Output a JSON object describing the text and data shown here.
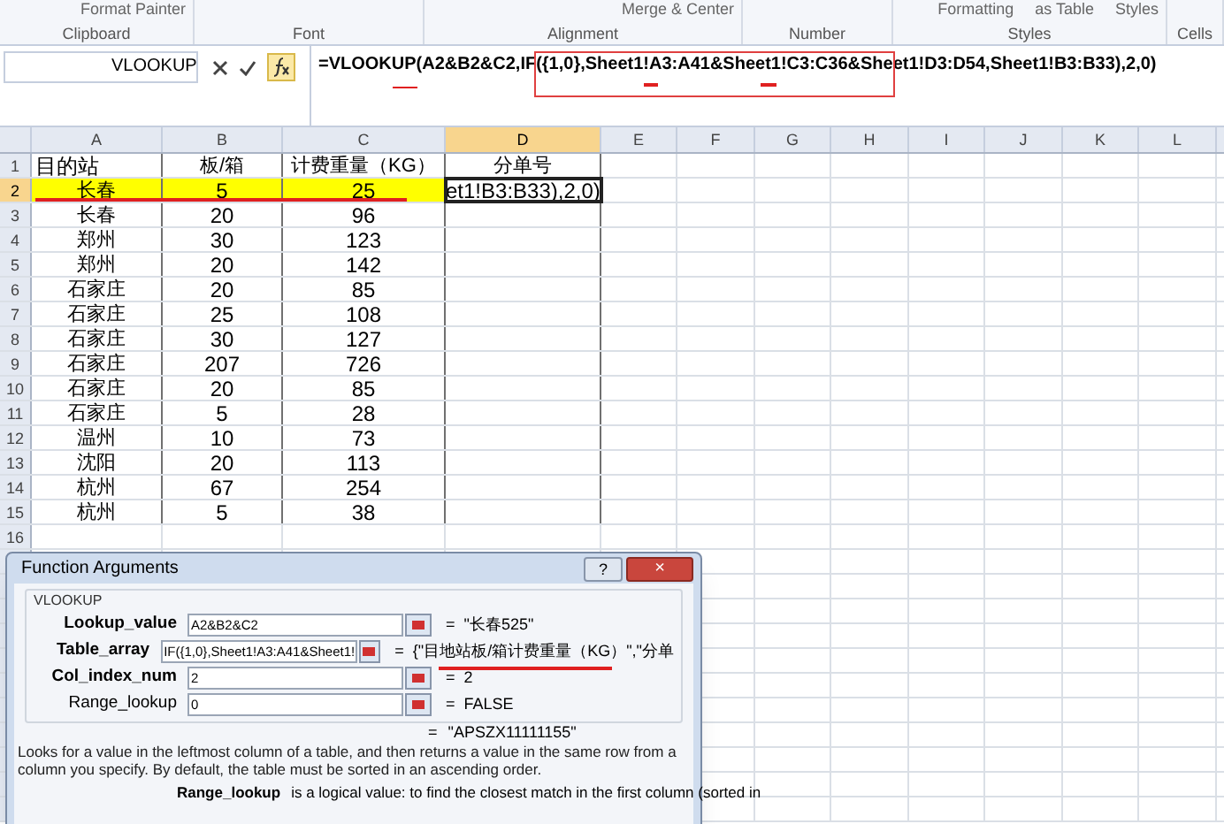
{
  "ribbon": {
    "groups": [
      {
        "label": "Clipboard",
        "items": [
          "Format Painter"
        ]
      },
      {
        "label": "Font"
      },
      {
        "label": "Alignment",
        "items": [
          "Merge & Center"
        ]
      },
      {
        "label": "Number"
      },
      {
        "label": "Styles",
        "items": [
          "Formatting",
          "as Table",
          "Styles"
        ]
      },
      {
        "label": "Cells"
      }
    ]
  },
  "formula_bar": {
    "name_box": "VLOOKUP",
    "formula": "=VLOOKUP(A2&B2&C2,IF({1,0},Sheet1!A3:A41&Sheet1!C3:C36&Sheet1!D3:D54,Sheet1!B3:B33),2,0)"
  },
  "sheet": {
    "columns": [
      {
        "label": "A",
        "selected": false
      },
      {
        "label": "B",
        "selected": false
      },
      {
        "label": "C",
        "selected": false
      },
      {
        "label": "D",
        "selected": true
      },
      {
        "label": "E",
        "selected": false
      },
      {
        "label": "F",
        "selected": false
      },
      {
        "label": "G",
        "selected": false
      },
      {
        "label": "H",
        "selected": false
      },
      {
        "label": "I",
        "selected": false
      },
      {
        "label": "J",
        "selected": false
      },
      {
        "label": "K",
        "selected": false
      },
      {
        "label": "L",
        "selected": false
      }
    ],
    "rows": [
      {
        "number": "1",
        "selected": false,
        "highlighted": false,
        "cells": [
          "目的站",
          "板/箱",
          "计费重量（KG）",
          "分单号"
        ]
      },
      {
        "number": "2",
        "selected": true,
        "highlighted": true,
        "cells": [
          "长春",
          "5",
          "25",
          "et1!B3:B33),2,0)"
        ]
      },
      {
        "number": "3",
        "selected": false,
        "highlighted": false,
        "cells": [
          "长春",
          "20",
          "96"
        ]
      },
      {
        "number": "4",
        "selected": false,
        "highlighted": false,
        "cells": [
          "郑州",
          "30",
          "123"
        ]
      },
      {
        "number": "5",
        "selected": false,
        "highlighted": false,
        "cells": [
          "郑州",
          "20",
          "142"
        ]
      },
      {
        "number": "6",
        "selected": false,
        "highlighted": false,
        "cells": [
          "石家庄",
          "20",
          "85"
        ]
      },
      {
        "number": "7",
        "selected": false,
        "highlighted": false,
        "cells": [
          "石家庄",
          "25",
          "108"
        ]
      },
      {
        "number": "8",
        "selected": false,
        "highlighted": false,
        "cells": [
          "石家庄",
          "30",
          "127"
        ]
      },
      {
        "number": "9",
        "selected": false,
        "highlighted": false,
        "cells": [
          "石家庄",
          "207",
          "726"
        ]
      },
      {
        "number": "10",
        "selected": false,
        "highlighted": false,
        "cells": [
          "石家庄",
          "20",
          "85"
        ]
      },
      {
        "number": "11",
        "selected": false,
        "highlighted": false,
        "cells": [
          "石家庄",
          "5",
          "28"
        ]
      },
      {
        "number": "12",
        "selected": false,
        "highlighted": false,
        "cells": [
          "温州",
          "10",
          "73"
        ]
      },
      {
        "number": "13",
        "selected": false,
        "highlighted": false,
        "cells": [
          "沈阳",
          "20",
          "113"
        ]
      },
      {
        "number": "14",
        "selected": false,
        "highlighted": false,
        "cells": [
          "杭州",
          "67",
          "254"
        ]
      },
      {
        "number": "15",
        "selected": false,
        "highlighted": false,
        "cells": [
          "杭州",
          "5",
          "38"
        ]
      },
      {
        "number": "16",
        "selected": false,
        "highlighted": false,
        "cells": []
      }
    ]
  },
  "dialog": {
    "title": "Function Arguments",
    "help": "?",
    "close": "×",
    "function": "VLOOKUP",
    "arguments": [
      {
        "label": "Lookup_value",
        "kind": "required",
        "value": "A2&B2&C2",
        "result": "\"长春525\""
      },
      {
        "label": "Table_array",
        "kind": "required",
        "value": "IF({1,0},Sheet1!A3:A41&Sheet1!",
        "result": "{\"目地站板/箱计费重量（KG）\",\"分单"
      },
      {
        "label": "Col_index_num",
        "kind": "required",
        "value": "2",
        "result": "2"
      },
      {
        "label": "Range_lookup",
        "kind": "optional",
        "value": "0",
        "result": "FALSE"
      }
    ],
    "equals": "=",
    "formula_result": "\"APSZX11111155\"",
    "description": "Looks for a value in the leftmost column of a table, and then returns a value in the same row from a column you specify. By default, the table must be sorted in an ascending order.",
    "argument_help": {
      "name": "Range_lookup",
      "text": "is a logical value: to find the closest match in the first column (sorted in"
    }
  }
}
